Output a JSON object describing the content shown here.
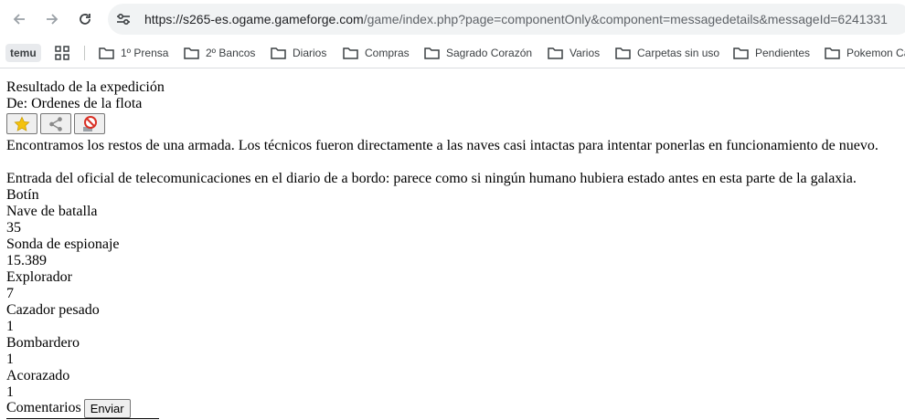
{
  "browser": {
    "url_host": "https://s265-es.ogame.gameforge.com",
    "url_path": "/game/index.php?page=componentOnly&component=messagedetails&messageId=6241331"
  },
  "bookmarks": [
    {
      "label": "temu"
    },
    {
      "label": "1º Prensa"
    },
    {
      "label": "2º Bancos"
    },
    {
      "label": "Diarios"
    },
    {
      "label": "Compras"
    },
    {
      "label": "Sagrado Corazón"
    },
    {
      "label": "Varios"
    },
    {
      "label": "Carpetas sin uso"
    },
    {
      "label": "Pendientes"
    },
    {
      "label": "Pokemon Ca"
    }
  ],
  "message": {
    "title": "Resultado de la expedición",
    "from": "De: Ordenes de la flota",
    "body1": "Encontramos los restos de una armada. Los técnicos fueron directamente a las naves casi intactas para intentar ponerlas en funcionamiento de nuevo.",
    "body2": "Entrada del oficial de telecomunicaciones en el diario de a bordo: parece como si ningún humano hubiera estado antes en esta parte de la galaxia.",
    "loot_label": "Botín",
    "loot": [
      {
        "name": "Nave de batalla",
        "count": "35"
      },
      {
        "name": "Sonda de espionaje",
        "count": "15.389"
      },
      {
        "name": "Explorador",
        "count": "7"
      },
      {
        "name": "Cazador pesado",
        "count": "1"
      },
      {
        "name": "Bombardero",
        "count": "1"
      },
      {
        "name": "Acorazado",
        "count": "1"
      }
    ],
    "comments_label": "Comentarios",
    "send_label": "Enviar"
  },
  "colors": {
    "star": "#f4c20d",
    "block": "#d93025"
  }
}
